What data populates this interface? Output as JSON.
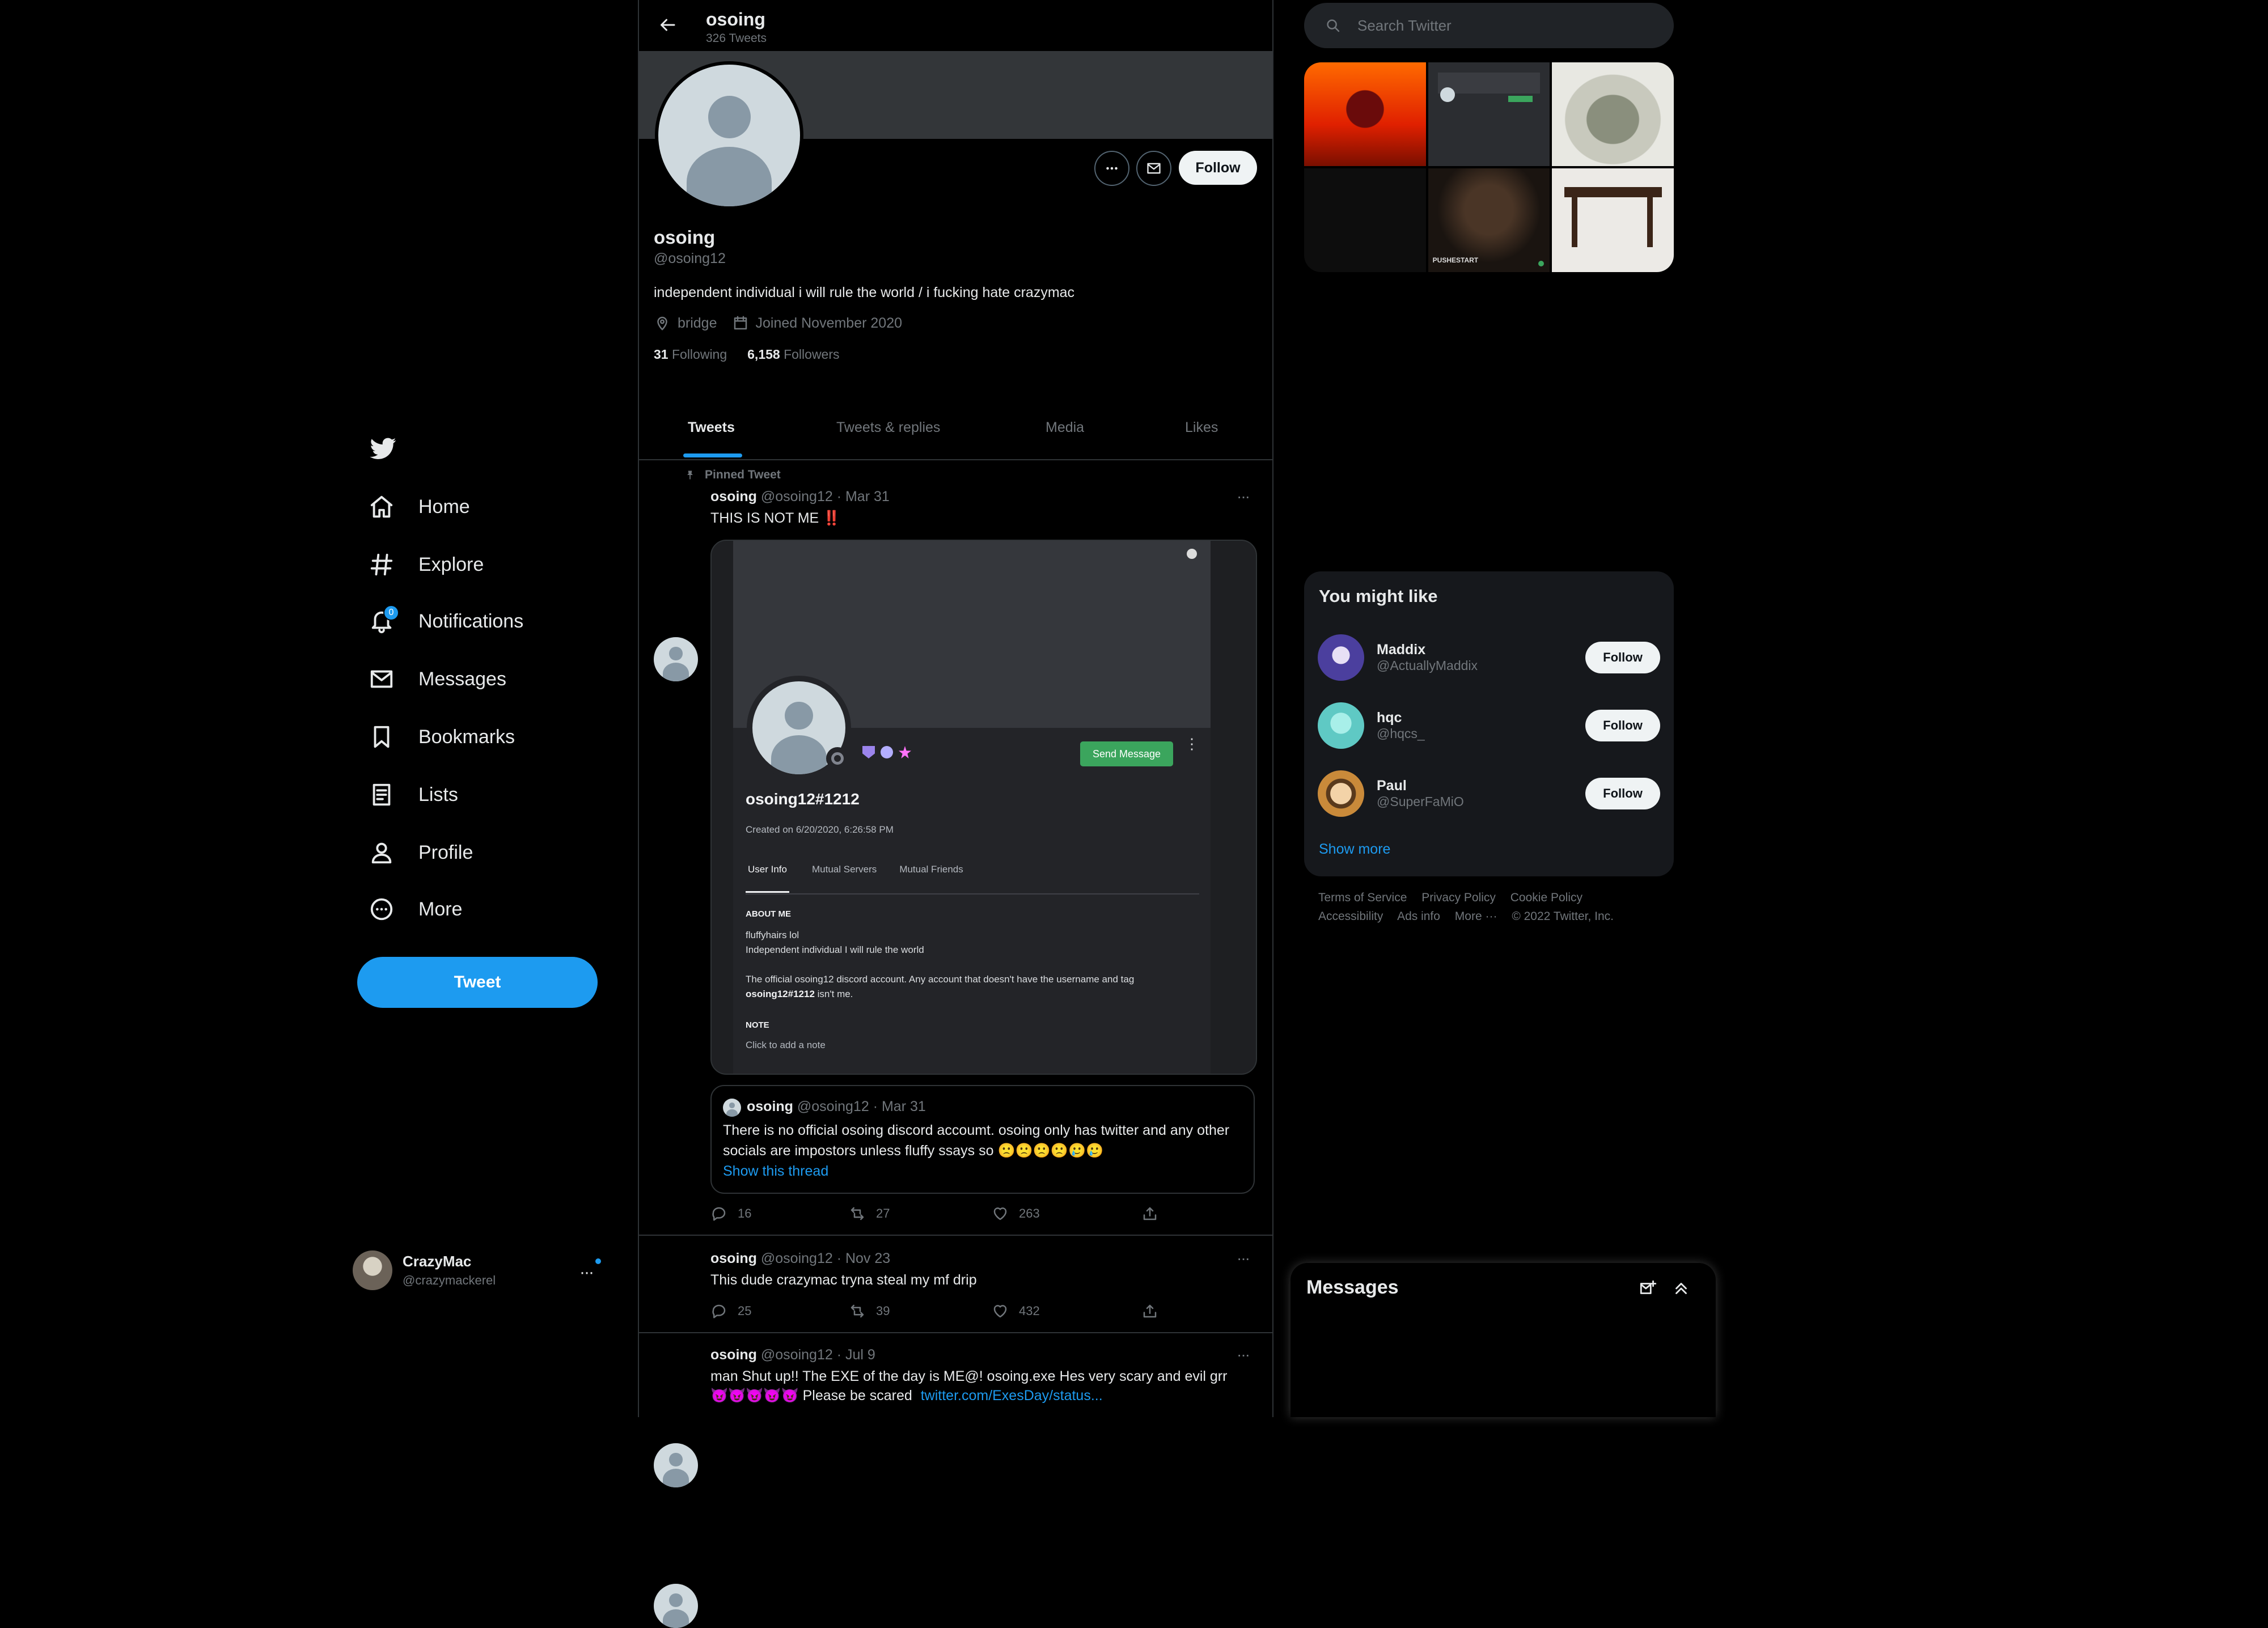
{
  "nav": {
    "items": [
      {
        "label": "Home",
        "icon": "home-icon"
      },
      {
        "label": "Explore",
        "icon": "hashtag-icon"
      },
      {
        "label": "Notifications",
        "icon": "bell-icon",
        "badge": "0"
      },
      {
        "label": "Messages",
        "icon": "mail-icon"
      },
      {
        "label": "Bookmarks",
        "icon": "bookmark-icon"
      },
      {
        "label": "Lists",
        "icon": "list-icon"
      },
      {
        "label": "Profile",
        "icon": "person-icon"
      },
      {
        "label": "More",
        "icon": "more-circle-icon"
      }
    ],
    "tweet_button": "Tweet",
    "account": {
      "name": "CrazyMac",
      "handle": "@crazymackerel"
    }
  },
  "profile": {
    "header_name": "osoing",
    "tweet_count": "326 Tweets",
    "name": "osoing",
    "handle": "@osoing12",
    "bio": "independent individual i will rule the world / i fucking hate crazymac",
    "location": "bridge",
    "joined": "Joined November 2020",
    "following_count": "31",
    "following_label": "Following",
    "followers_count": "6,158",
    "followers_label": "Followers",
    "follow_button": "Follow",
    "tabs": [
      "Tweets",
      "Tweets & replies",
      "Media",
      "Likes"
    ],
    "active_tab": "Tweets"
  },
  "tweets": [
    {
      "pinned_label": "Pinned Tweet",
      "name": "osoing",
      "handle": "@osoing12",
      "date": "· Mar 31",
      "text": "THIS IS NOT ME",
      "emoji_suffix": "‼️",
      "discord": {
        "username": "osoing12#1212",
        "created": "Created on 6/20/2020, 6:26:58 PM",
        "send_message": "Send Message",
        "tabs": [
          "User Info",
          "Mutual Servers",
          "Mutual Friends"
        ],
        "about_heading": "ABOUT ME",
        "about_lines": [
          "fluffyhairs lol",
          "Independent individual I will rule the world"
        ],
        "about_official": "The official osoing12 discord account. Any account that doesn't have the username and tag",
        "about_official_bold": "osoing12#1212",
        "about_official_tail": "isn't me.",
        "note_heading": "NOTE",
        "note_text": "Click to add a note"
      },
      "quote": {
        "name": "osoing",
        "handle": "@osoing12",
        "date": "· Mar 31",
        "text": "There is no official osoing discord accoumt. osoing only has twitter and any other socials are impostors unless fluffy ssays so 🙁🙁🙁🙁🥲🥲",
        "show_thread": "Show this thread"
      },
      "replies": "16",
      "retweets": "27",
      "likes": "263"
    },
    {
      "name": "osoing",
      "handle": "@osoing12",
      "date": "· Nov 23",
      "text": "This dude crazymac tryna steal my mf drip",
      "replies": "25",
      "retweets": "39",
      "likes": "432"
    },
    {
      "name": "osoing",
      "handle": "@osoing12",
      "date": "· Jul 9",
      "text_line1": "man Shut up!! The EXE of the day is ME@! osoing.exe Hes very scary and evil grr",
      "text_line2": "😈😈😈😈😈 Please be scared",
      "link": "twitter.com/ExesDay/status..."
    }
  ],
  "search": {
    "placeholder": "Search Twitter"
  },
  "media_tiles": [
    "devil-fire",
    "discord-screenshot",
    "money-roll",
    "dark-image",
    "album-cover",
    "wooden-table"
  ],
  "media_tile_text": "PUSHESTART",
  "who_to_follow": {
    "title": "You might like",
    "users": [
      {
        "name": "Maddix",
        "handle": "@ActuallyMaddix",
        "button": "Follow",
        "color": "#4b3f9e"
      },
      {
        "name": "hqc",
        "handle": "@hqcs_",
        "button": "Follow",
        "color": "#5fc9c4"
      },
      {
        "name": "Paul",
        "handle": "@SuperFaMiO",
        "button": "Follow",
        "color": "#c98a3a"
      }
    ],
    "show_more": "Show more"
  },
  "footer": {
    "links_row1": [
      "Terms of Service",
      "Privacy Policy",
      "Cookie Policy"
    ],
    "links_row2": [
      "Accessibility",
      "Ads info",
      "More ···"
    ],
    "copyright": "© 2022 Twitter, Inc."
  },
  "messages_drawer": {
    "title": "Messages"
  },
  "colors": {
    "accent": "#1d9bf0",
    "background": "#000000",
    "discord_green": "#3ba55d"
  }
}
